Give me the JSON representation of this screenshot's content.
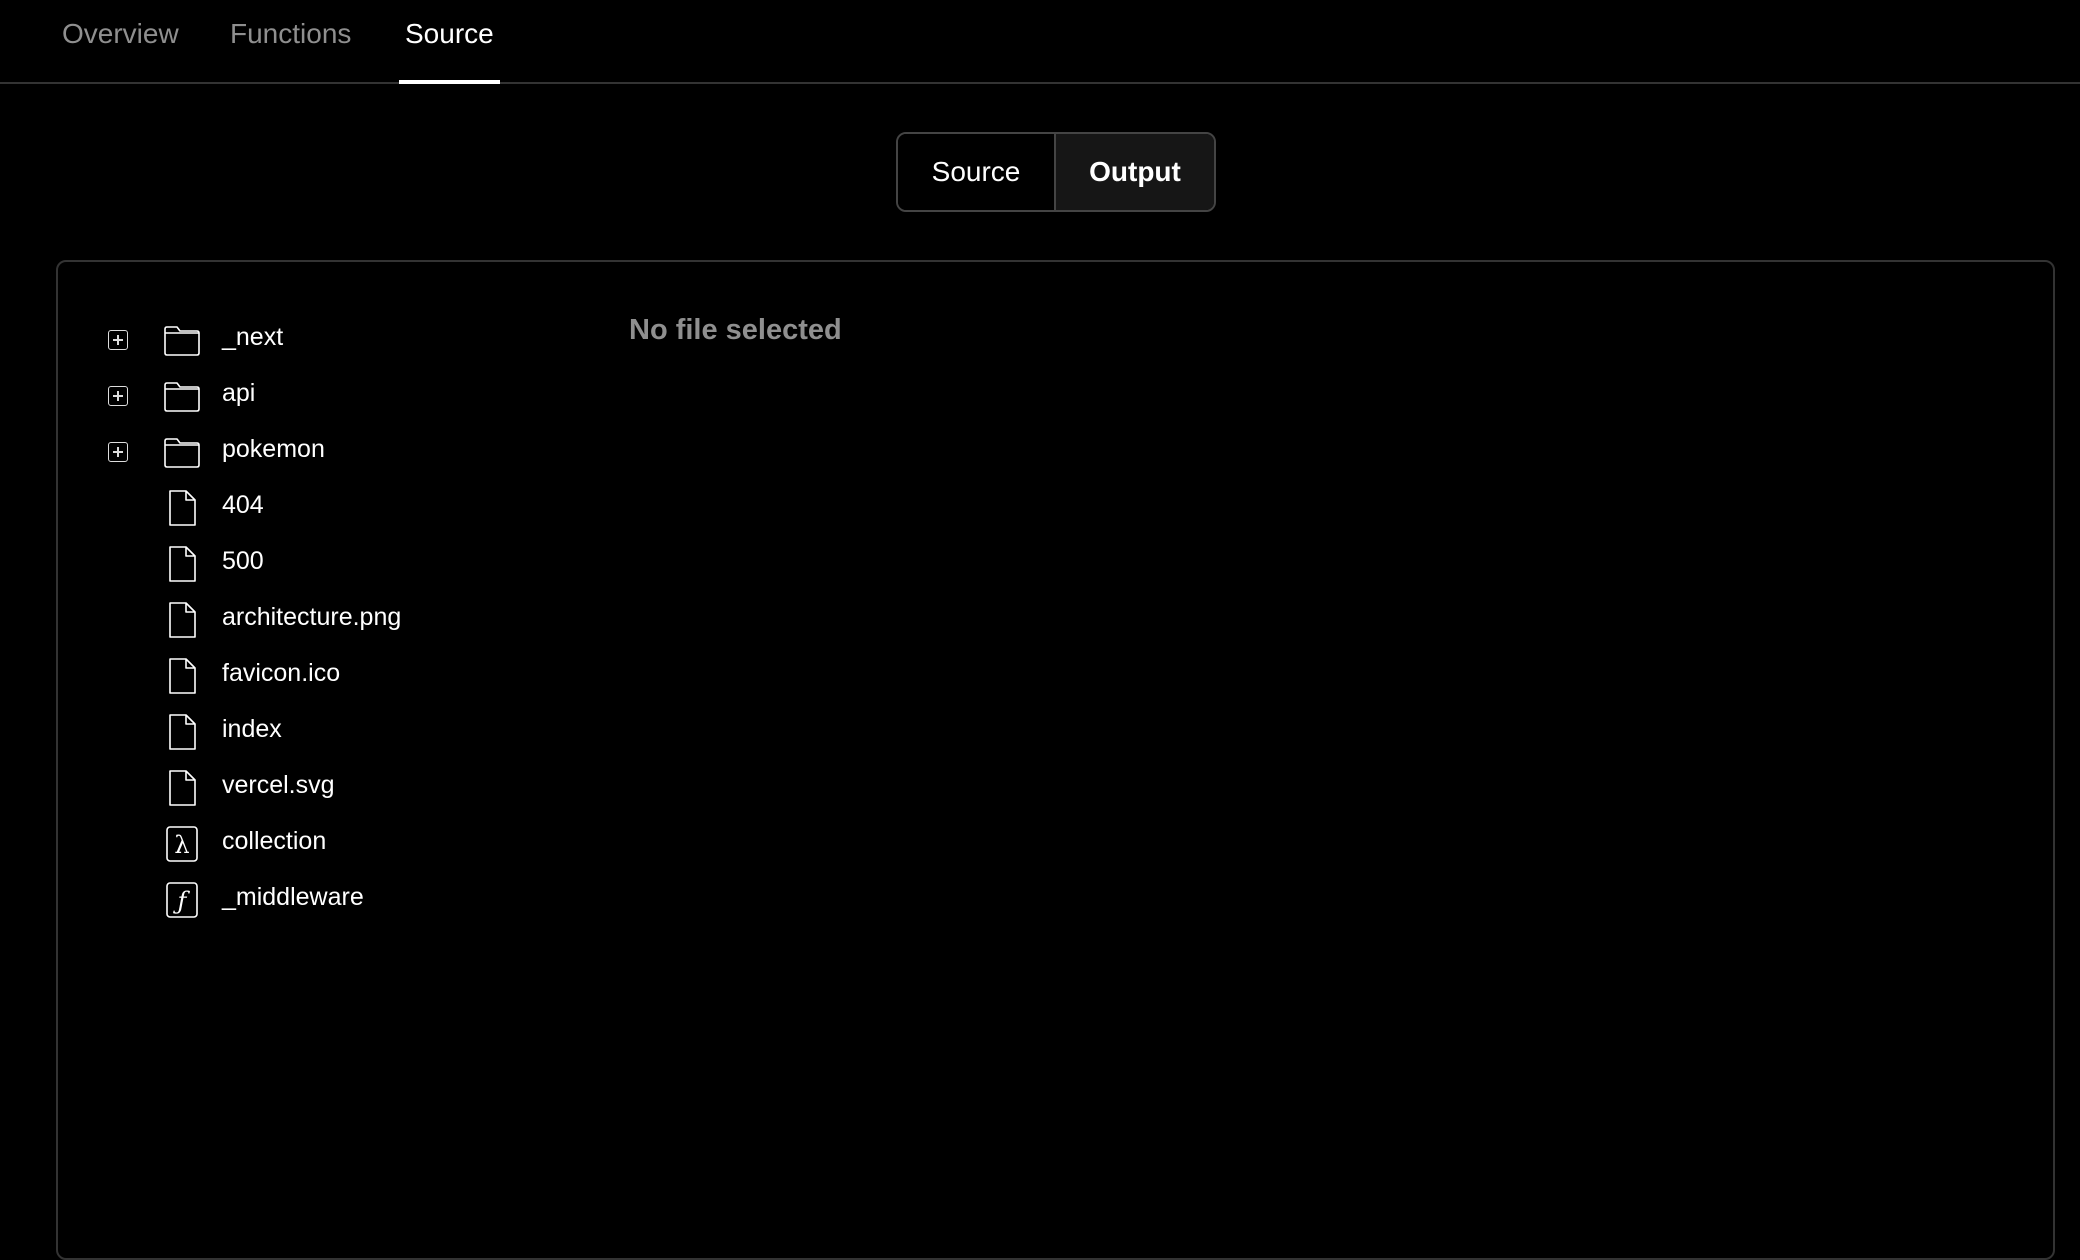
{
  "tabs": [
    {
      "label": "Overview",
      "active": false
    },
    {
      "label": "Functions",
      "active": false
    },
    {
      "label": "Source",
      "active": true
    }
  ],
  "toggle": {
    "source_label": "Source",
    "output_label": "Output",
    "selected": "Output"
  },
  "viewer": {
    "empty_message": "No file selected"
  },
  "tree": [
    {
      "name": "_next",
      "type": "folder",
      "icon": "folder-icon",
      "expandable": true
    },
    {
      "name": "api",
      "type": "folder",
      "icon": "folder-icon",
      "expandable": true
    },
    {
      "name": "pokemon",
      "type": "folder",
      "icon": "folder-icon",
      "expandable": true
    },
    {
      "name": "404",
      "type": "file",
      "icon": "file-icon",
      "expandable": false
    },
    {
      "name": "500",
      "type": "file",
      "icon": "file-icon",
      "expandable": false
    },
    {
      "name": "architecture.png",
      "type": "file",
      "icon": "file-icon",
      "expandable": false
    },
    {
      "name": "favicon.ico",
      "type": "file",
      "icon": "file-icon",
      "expandable": false
    },
    {
      "name": "index",
      "type": "file",
      "icon": "file-icon",
      "expandable": false
    },
    {
      "name": "vercel.svg",
      "type": "file",
      "icon": "file-icon",
      "expandable": false
    },
    {
      "name": "collection",
      "type": "lambda",
      "icon": "lambda-function-icon",
      "expandable": false
    },
    {
      "name": "_middleware",
      "type": "edge-function",
      "icon": "edge-function-icon",
      "expandable": false
    }
  ]
}
